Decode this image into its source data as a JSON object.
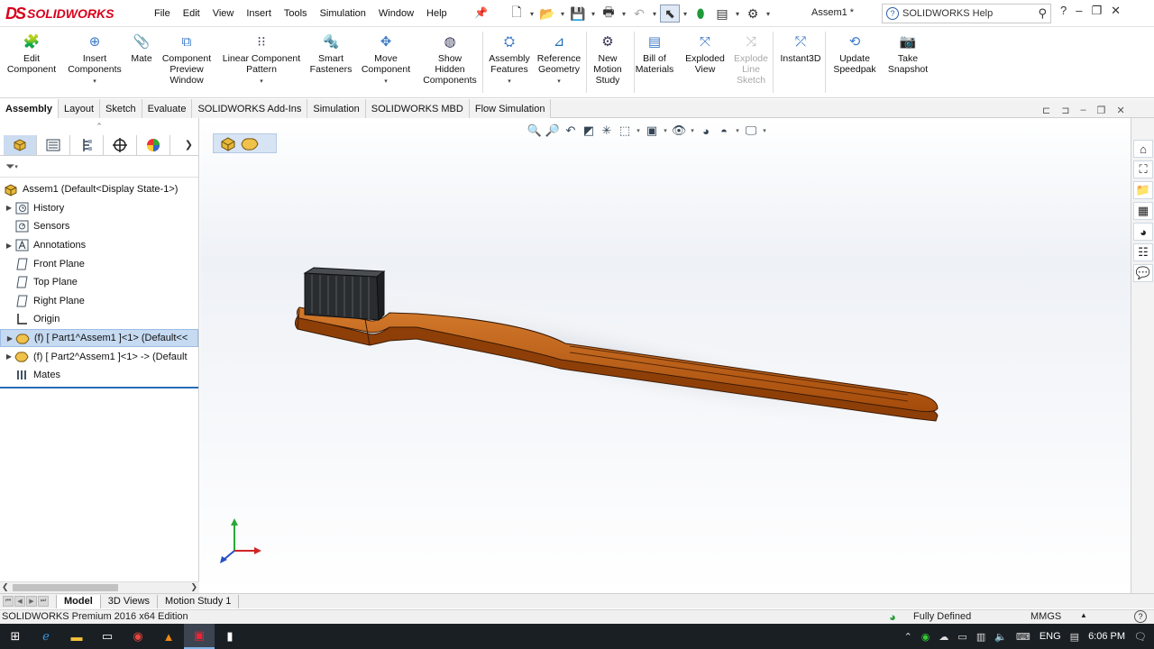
{
  "title_bar": {
    "brand": "SOLIDWORKS",
    "menu": [
      "File",
      "Edit",
      "View",
      "Insert",
      "Tools",
      "Simulation",
      "Window",
      "Help"
    ],
    "document_title": "Assem1 *",
    "help_search_placeholder": "SOLIDWORKS Help",
    "window_buttons": [
      "?",
      "–",
      "❐",
      "✕"
    ]
  },
  "command_manager": {
    "items": [
      {
        "label": "Edit\nComponent"
      },
      {
        "label": "Insert\nComponents"
      },
      {
        "label": "Mate"
      },
      {
        "label": "Component\nPreview\nWindow"
      },
      {
        "label": "Linear Component\nPattern"
      },
      {
        "label": "Smart\nFasteners"
      },
      {
        "label": "Move\nComponent"
      },
      {
        "label": "Show\nHidden\nComponents"
      },
      {
        "label": "Assembly\nFeatures"
      },
      {
        "label": "Reference\nGeometry"
      },
      {
        "label": "New\nMotion\nStudy"
      },
      {
        "label": "Bill of\nMaterials"
      },
      {
        "label": "Exploded\nView"
      },
      {
        "label": "Explode\nLine\nSketch"
      },
      {
        "label": "Instant3D"
      },
      {
        "label": "Update\nSpeedpak"
      },
      {
        "label": "Take\nSnapshot"
      }
    ]
  },
  "tabs": [
    "Assembly",
    "Layout",
    "Sketch",
    "Evaluate",
    "SOLIDWORKS Add-Ins",
    "Simulation",
    "SOLIDWORKS MBD",
    "Flow Simulation"
  ],
  "active_tab": "Assembly",
  "feature_tree": {
    "root": "Assem1  (Default<Display State-1>)",
    "items": [
      {
        "label": "History"
      },
      {
        "label": "Sensors"
      },
      {
        "label": "Annotations"
      },
      {
        "label": "Front Plane"
      },
      {
        "label": "Top Plane"
      },
      {
        "label": "Right Plane"
      },
      {
        "label": "Origin"
      },
      {
        "label": "(f) [ Part1^Assem1 ]<1> (Default<<"
      },
      {
        "label": "(f) [ Part2^Assem1 ]<1> -> (Default"
      },
      {
        "label": "Mates"
      }
    ]
  },
  "bottom_tabs": [
    "Model",
    "3D Views",
    "Motion Study 1"
  ],
  "active_bottom_tab": "Model",
  "status_bar": {
    "edition": "SOLIDWORKS Premium 2016 x64 Edition",
    "state": "Fully Defined",
    "units": "MMGS"
  },
  "taskbar": {
    "language": "ENG",
    "time": "6:06 PM"
  },
  "colors": {
    "model_body": "#b4560f",
    "bristles": "#2a2d30",
    "selection": "#c6daf1",
    "brand_red": "#d9001b"
  }
}
